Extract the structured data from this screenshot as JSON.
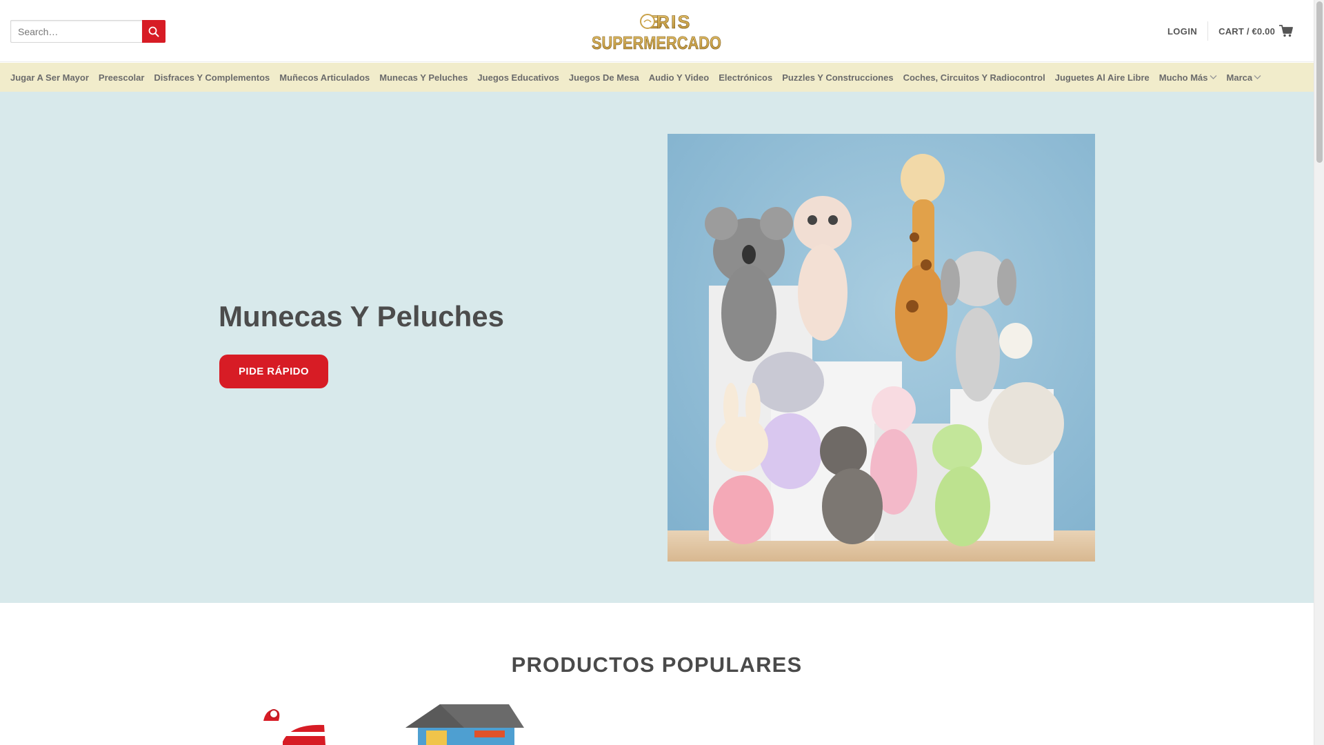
{
  "header": {
    "search": {
      "placeholder": "Search…",
      "value": ""
    },
    "logo_text": [
      "BORIS",
      "SUPERMERCADO"
    ],
    "login_label": "LOGIN",
    "cart_label": "CART / €0.00"
  },
  "nav": {
    "items": [
      {
        "label": "Jugar A Ser Mayor"
      },
      {
        "label": "Preescolar"
      },
      {
        "label": "Disfraces Y Complementos"
      },
      {
        "label": "Muñecos Articulados"
      },
      {
        "label": "Munecas Y Peluches"
      },
      {
        "label": "Juegos Educativos"
      },
      {
        "label": "Juegos De Mesa"
      },
      {
        "label": "Audio Y Video"
      },
      {
        "label": "Electrónicos"
      },
      {
        "label": "Puzzles Y Construcciones"
      },
      {
        "label": "Coches, Circuitos Y Radiocontrol"
      },
      {
        "label": "Juguetes Al Aire Libre"
      },
      {
        "label": "Mucho Más"
      },
      {
        "label": "Marca"
      }
    ]
  },
  "hero": {
    "title": "Munecas Y Peluches",
    "button_label": "PIDE RÁPIDO"
  },
  "popular": {
    "title": "PRODUCTOS POPULARES"
  },
  "colors": {
    "accent": "#d71c25",
    "nav_bg": "#f1eccb",
    "hero_bg": "#d8e9eb",
    "logo_gold": "#c9a24a"
  }
}
